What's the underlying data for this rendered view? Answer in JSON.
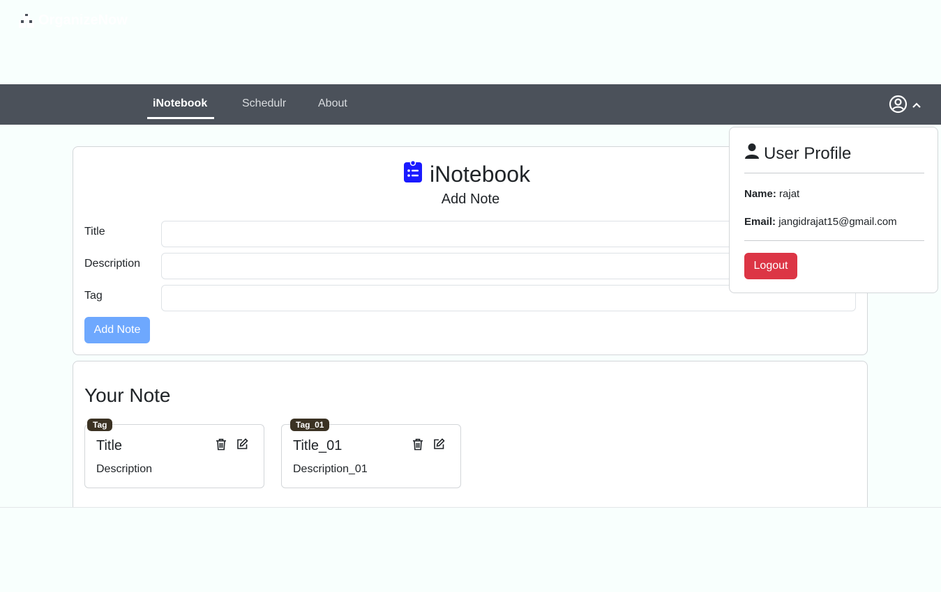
{
  "navbar": {
    "brand": "OrganizeNow",
    "links": [
      {
        "label": "iNotebook",
        "active": true
      },
      {
        "label": "Schedulr",
        "active": false
      },
      {
        "label": "About",
        "active": false
      }
    ],
    "user_icon": "user-circle-icon",
    "chevron_icon": "chevron-up-icon"
  },
  "main": {
    "app_title": "iNotebook",
    "app_icon": "clipboard-list-icon",
    "subtitle": "Add Note",
    "fields": [
      {
        "label": "Title",
        "value": ""
      },
      {
        "label": "Description",
        "value": ""
      },
      {
        "label": "Tag",
        "value": ""
      }
    ],
    "add_button": "Add Note"
  },
  "notes": {
    "heading": "Your Note",
    "items": [
      {
        "tag": "Tag",
        "title": "Title",
        "description": "Description"
      },
      {
        "tag": "Tag_01",
        "title": "Title_01",
        "description": "Description_01"
      }
    ]
  },
  "profile": {
    "title": "User Profile",
    "name_label": "Name:",
    "name": "rajat",
    "email_label": "Email:",
    "email": "jangidrajat15@gmail.com",
    "logout": "Logout"
  },
  "colors": {
    "navbar": "#4b515a",
    "accent_blue": "#1a1aff",
    "add_button": "#6ea8fe",
    "logout": "#dc3545",
    "badge": "#3b3223"
  }
}
